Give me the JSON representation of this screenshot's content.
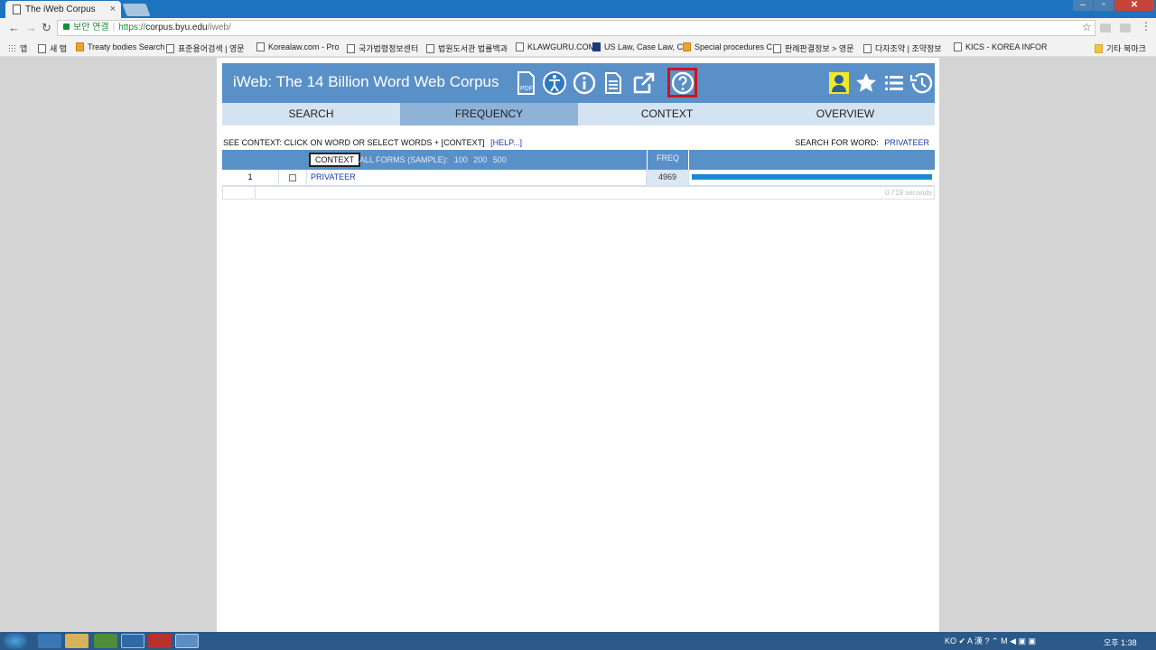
{
  "browser": {
    "tab_title": "The iWeb Corpus",
    "tab_close": "×",
    "controls": {
      "minimize": "–",
      "maximize": "▫",
      "close": "✕"
    },
    "nav": {
      "back": "←",
      "forward": "→",
      "reload": "↻"
    },
    "secure_label": "보안 연결",
    "url_scheme": "https://",
    "url_host": "corpus.byu.edu",
    "url_path": "/iweb/",
    "star": "☆",
    "menu": "⋮"
  },
  "bookmarks": {
    "apps": "앱",
    "items": [
      "새 탭",
      "Treaty bodies Search",
      "표준용어검색 | 영문",
      "Korealaw.com - Pro",
      "국가법령정보센터",
      "법원도서관 법률백과",
      "KLAWGURU.COM",
      "US Law, Case Law, C",
      "Special procedures C",
      "판례판결정보 > 영문",
      "다자조약 | 조약정보",
      "KICS - KOREA INFOR"
    ],
    "other": "기타 북마크"
  },
  "site": {
    "title": "iWeb: The 14 Billion Word Web Corpus",
    "icons": [
      "pdf-icon",
      "accessibility-icon",
      "info-icon",
      "document-icon",
      "external-link-icon",
      "help-icon",
      "user-icon",
      "star-icon",
      "list-icon",
      "history-icon"
    ],
    "help_highlight_color": "#d0121b",
    "header_color": "#5a90c8"
  },
  "tabs": [
    {
      "label": "SEARCH",
      "active": false
    },
    {
      "label": "FREQUENCY",
      "active": true
    },
    {
      "label": "CONTEXT",
      "active": false
    },
    {
      "label": "OVERVIEW",
      "active": false
    }
  ],
  "hint": {
    "text": "SEE CONTEXT: CLICK ON WORD OR SELECT WORDS + [CONTEXT]",
    "help_link": "[HELP...]"
  },
  "search_for": {
    "label": "SEARCH FOR WORD:",
    "word": "PRIVATEER"
  },
  "results": {
    "context_button": "CONTEXT",
    "forms_label": "ALL FORMS (SAMPLE):",
    "samples": [
      "100",
      "200",
      "500"
    ],
    "freq_header": "FREQ",
    "rows": [
      {
        "num": "1",
        "word": "PRIVATEER",
        "freq": "4969",
        "bar_fraction": 1.0
      }
    ],
    "timing": "0.719 seconds"
  },
  "taskbar": {
    "tray_text": "KO ✔ A 漢 ? ⌃ M ◀ ▣ ▣",
    "clock": "오후 1:38"
  }
}
